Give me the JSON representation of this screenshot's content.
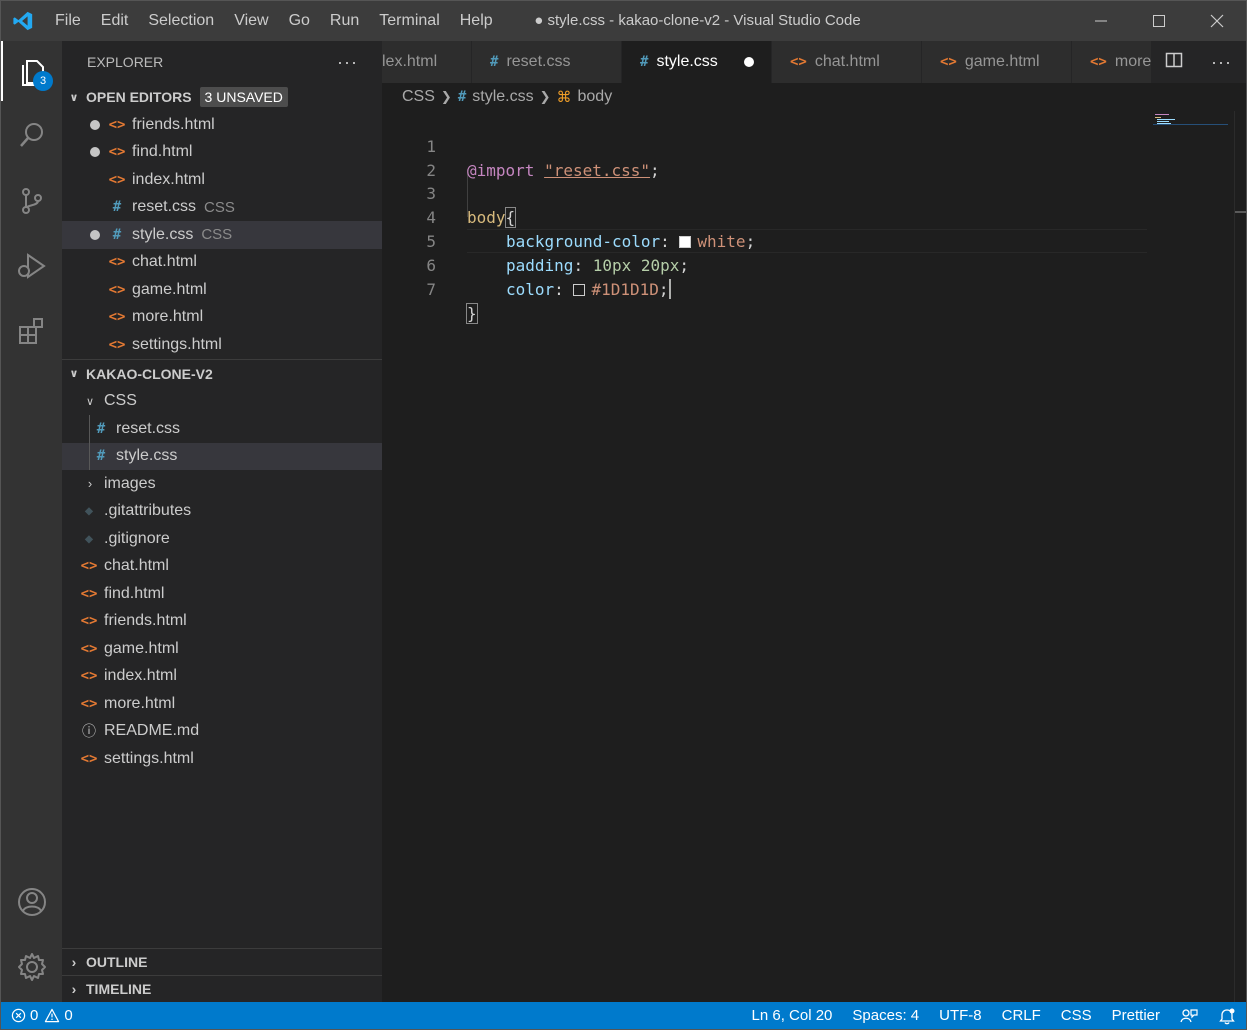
{
  "window": {
    "title": "● style.css - kakao-clone-v2 - Visual Studio Code",
    "menu": [
      "File",
      "Edit",
      "Selection",
      "View",
      "Go",
      "Run",
      "Terminal",
      "Help"
    ]
  },
  "activity": {
    "explorer_badge": "3"
  },
  "sidebar": {
    "header": "EXPLORER",
    "more": "···",
    "open_editors": {
      "title": "OPEN EDITORS",
      "unsaved": "3 UNSAVED",
      "items": [
        {
          "name": "friends.html",
          "desc": ""
        },
        {
          "name": "find.html",
          "desc": ""
        },
        {
          "name": "index.html",
          "desc": ""
        },
        {
          "name": "reset.css",
          "desc": "CSS"
        },
        {
          "name": "style.css",
          "desc": "CSS"
        },
        {
          "name": "chat.html",
          "desc": ""
        },
        {
          "name": "game.html",
          "desc": ""
        },
        {
          "name": "more.html",
          "desc": ""
        },
        {
          "name": "settings.html",
          "desc": ""
        }
      ]
    },
    "project": {
      "title": "KAKAO-CLONE-V2",
      "folder_css": "CSS",
      "css_files": [
        "reset.css",
        "style.css"
      ],
      "folder_images": "images",
      "files": [
        ".gitattributes",
        ".gitignore",
        "chat.html",
        "find.html",
        "friends.html",
        "game.html",
        "index.html",
        "more.html",
        "README.md",
        "settings.html"
      ]
    },
    "outline": "OUTLINE",
    "timeline": "TIMELINE"
  },
  "tabs": [
    {
      "label": "lex.html"
    },
    {
      "label": "reset.css"
    },
    {
      "label": "style.css"
    },
    {
      "label": "chat.html"
    },
    {
      "label": "game.html"
    },
    {
      "label": "more"
    }
  ],
  "breadcrumb": [
    "CSS",
    "style.css",
    "body"
  ],
  "editor": {
    "line_numbers": [
      "1",
      "2",
      "3",
      "4",
      "5",
      "6",
      "7"
    ],
    "l1_kw": "@import",
    "l1_str": "\"reset.css\"",
    "l1_end": ";",
    "l3_sel": "body",
    "l3_brace": "{",
    "l4_prop": "background-color",
    "l4_colon": ": ",
    "l4_val": "white",
    "l4_end": ";",
    "l5_prop": "padding",
    "l5_colon": ": ",
    "l5_val": "10px 20px",
    "l5_end": ";",
    "l6_prop": "color",
    "l6_colon": ": ",
    "l6_val": "#1D1D1D",
    "l6_end": ";",
    "l7_brace": "}"
  },
  "status": {
    "errors": "0",
    "warnings": "0",
    "position": "Ln 6, Col 20",
    "spaces": "Spaces: 4",
    "encoding": "UTF-8",
    "eol": "CRLF",
    "language": "CSS",
    "formatter": "Prettier"
  },
  "colors": {
    "accent": "#007acc",
    "html_icon": "#e37933",
    "css_icon": "#519aba"
  }
}
